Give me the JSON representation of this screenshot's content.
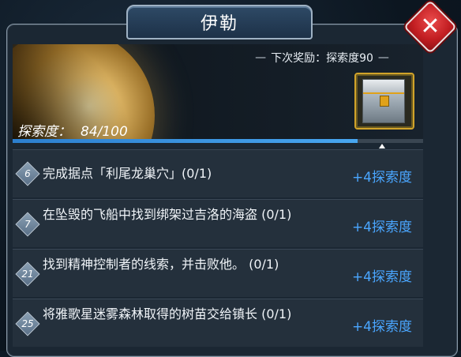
{
  "title": "伊勒",
  "close_label": "✕",
  "next_reward": "下次奖励：探索度90",
  "explore_label": "探索度：",
  "explore_value": "84/100",
  "progress_fraction": 0.84,
  "tasks": [
    {
      "num": "6",
      "text": "完成据点「利尾龙巢穴」(0/1)",
      "reward": "+4探索度"
    },
    {
      "num": "7",
      "text": "在坠毁的飞船中找到绑架过吉洛的海盗 (0/1)",
      "reward": "+4探索度"
    },
    {
      "num": "21",
      "text": "找到精神控制者的线索，并击败他。 (0/1)",
      "reward": "+4探索度"
    },
    {
      "num": "25",
      "text": "将雅歌星迷雾森林取得的树苗交给镇长 (0/1)",
      "reward": "+4探索度"
    }
  ],
  "colors": {
    "accent": "#4aa6ff",
    "close": "#c21e22",
    "chest_border": "#d1a32a"
  }
}
